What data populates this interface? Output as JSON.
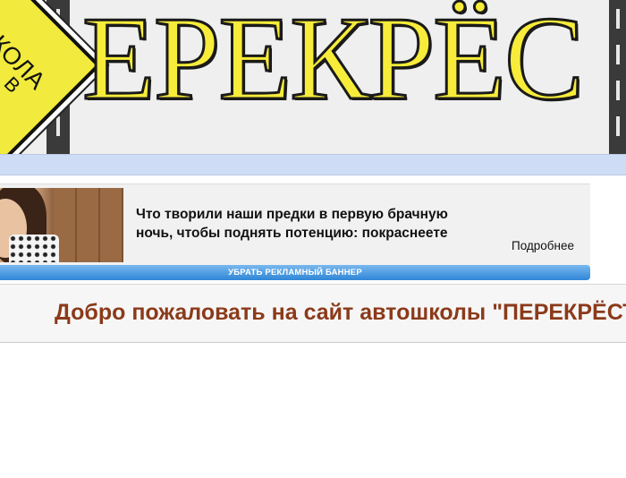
{
  "header": {
    "logo_text": "ЕРЕКРЁС",
    "sign_text": "ШКОЛА",
    "sign_sub": "В"
  },
  "ad": {
    "headline": "Что творили наши предки в первую брачную ночь, чтобы поднять потенцию: покраснеете",
    "more_label": "Подробнее",
    "remove_label": "УБРАТЬ РЕКЛАМНЫЙ БАННЕР"
  },
  "welcome": {
    "text": "Добро пожаловать на сайт автошколы \"ПЕРЕКРЁСТ"
  },
  "colors": {
    "logo_yellow": "#f7ec3a",
    "welcome_brown": "#8b3a1a",
    "remove_button_blue": "#2f86d8",
    "strip_blue": "#cfdcf5"
  }
}
